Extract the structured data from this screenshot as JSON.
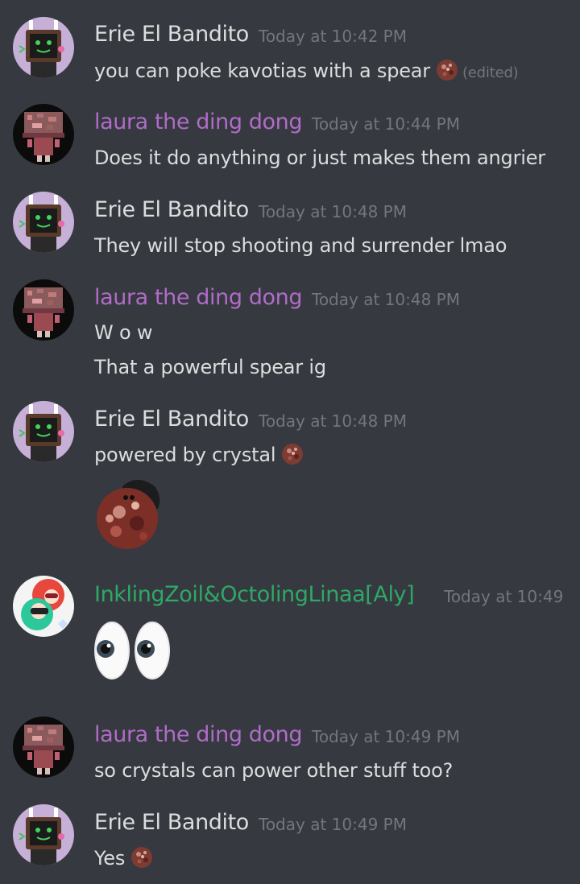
{
  "colors": {
    "background": "#36393f",
    "text": "#dcddde",
    "timestamp": "#72767d",
    "erie_name": "#dcddde",
    "laura_name": "#b06cc8",
    "inkling_name": "#2fa866"
  },
  "messages": [
    {
      "author": "Erie El Bandito",
      "time": "Today at 10:42 PM",
      "lines": [
        "you can poke kavotias with a spear"
      ],
      "edited": "(edited)"
    },
    {
      "author": "laura the ding dong",
      "time": "Today at 10:44 PM",
      "lines": [
        "Does it do anything or just makes them angrier"
      ]
    },
    {
      "author": "Erie El Bandito",
      "time": "Today at 10:48 PM",
      "lines": [
        "They will stop shooting and surrender lmao"
      ]
    },
    {
      "author": "laura the ding dong",
      "time": "Today at 10:48 PM",
      "lines": [
        "W o w",
        "That a powerful spear ig"
      ]
    },
    {
      "author": "Erie El Bandito",
      "time": "Today at 10:48 PM",
      "lines": [
        "powered by crystal"
      ]
    },
    {
      "author": "InklingZoil&OctolingLinaa[Aly]",
      "time": "Today at 10:49"
    },
    {
      "author": "laura the ding dong",
      "time": "Today at 10:49 PM",
      "lines": [
        "so crystals can power other stuff too?"
      ]
    },
    {
      "author": "Erie El Bandito",
      "time": "Today at 10:49 PM",
      "lines": [
        "Yes"
      ]
    }
  ]
}
